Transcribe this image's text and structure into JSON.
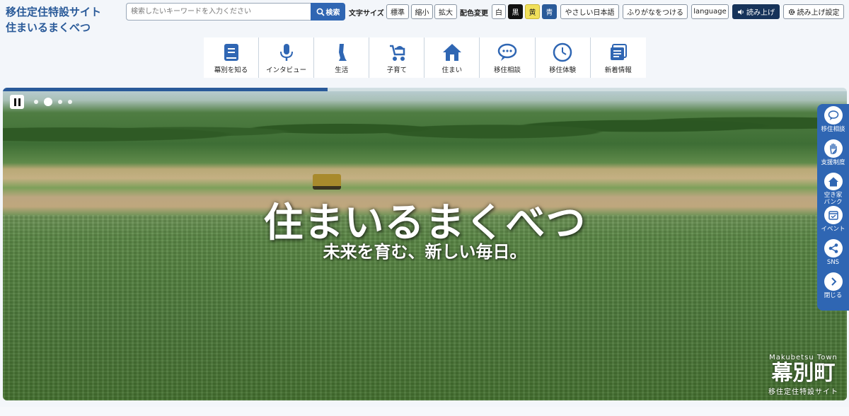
{
  "site": {
    "title_line1": "移住定住特設サイト",
    "title_line2": "住まいるまくべつ"
  },
  "search": {
    "placeholder": "検索したいキーワードを入力ください",
    "button_label": "検索"
  },
  "toolbar": {
    "font_size_label": "文字サイズ",
    "font_sizes": [
      "標準",
      "縮小",
      "拡大"
    ],
    "color_label": "配色変更",
    "colors": [
      "白",
      "黒",
      "黄",
      "青"
    ],
    "easy_japanese": "やさしい日本語",
    "furigana": "ふりがなをつける",
    "language": "language",
    "read_aloud": "読み上げ",
    "read_settings": "読み上げ設定"
  },
  "nav": [
    {
      "label": "幕別を知る",
      "icon": "book-icon"
    },
    {
      "label": "インタビュー",
      "icon": "microphone-icon"
    },
    {
      "label": "生活",
      "icon": "leg-icon"
    },
    {
      "label": "子育て",
      "icon": "stroller-icon"
    },
    {
      "label": "住まい",
      "icon": "house-icon"
    },
    {
      "label": "移住相談",
      "icon": "chat-icon"
    },
    {
      "label": "移住体験",
      "icon": "clock-icon"
    },
    {
      "label": "新着情報",
      "icon": "news-icon"
    }
  ],
  "hero": {
    "headline": "住まいるまくべつ",
    "tagline": "未来を育む、新しい毎日。",
    "logo_en": "Makubetsu Town",
    "logo_jp": "幕別町",
    "logo_sub": "移住定住特設サイト",
    "progress": 0.385
  },
  "side_panel": [
    {
      "label": "移住相談",
      "icon": "chat-icon"
    },
    {
      "label": "支援制度",
      "icon": "hand-icon"
    },
    {
      "label": "空き家\nバンク",
      "icon": "house-icon"
    },
    {
      "label": "イベント",
      "icon": "calendar-icon"
    },
    {
      "label": "SNS",
      "icon": "share-icon"
    },
    {
      "label": "閉じる",
      "icon": "chevron-right-icon"
    }
  ],
  "colors": {
    "primary": "#2f66b3",
    "title": "#2a5a99"
  }
}
